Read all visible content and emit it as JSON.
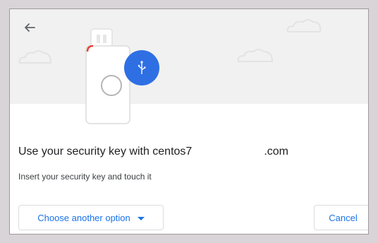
{
  "dialog": {
    "title_prefix": "Use your security key with centos7",
    "title_suffix": ".com",
    "subtitle": "Insert your security key and touch it"
  },
  "buttons": {
    "choose_another_option": "Choose another option",
    "cancel": "Cancel"
  },
  "icons": {
    "back": "arrow-back-icon",
    "usb": "usb-icon",
    "security_key": "security-key-illustration",
    "choose_caret": "caret-down-icon"
  },
  "colors": {
    "accent": "#1a73e8",
    "usb_circle": "#2f6fe4",
    "banner_bg": "#f1f1f1",
    "text_primary": "#202124",
    "text_secondary": "#3c4043"
  }
}
